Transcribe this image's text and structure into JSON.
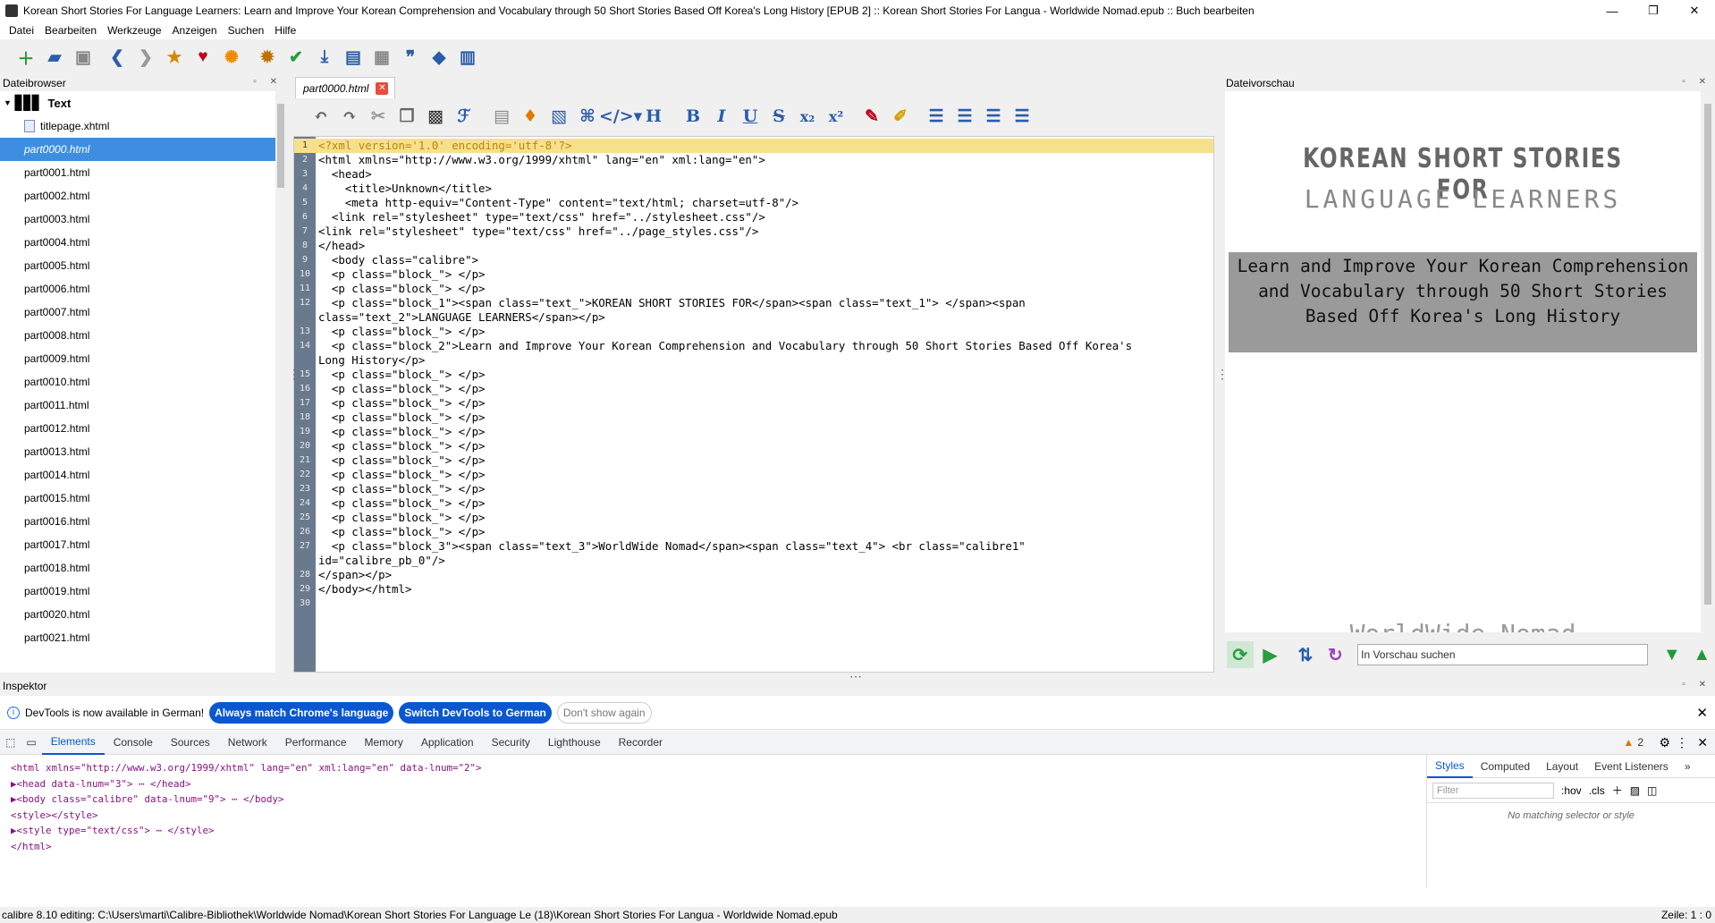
{
  "window": {
    "title": "Korean Short Stories For Language Learners: Learn and Improve Your Korean Comprehension and Vocabulary through 50 Short Stories Based Off Korea's Long History [EPUB 2] :: Korean Short Stories For Langua - Worldwide Nomad.epub :: Buch bearbeiten",
    "minimize": "—",
    "maximize": "❐",
    "close": "✕"
  },
  "menu": {
    "items": [
      "Datei",
      "Bearbeiten",
      "Werkzeuge",
      "Anzeigen",
      "Suchen",
      "Hilfe"
    ]
  },
  "file_browser": {
    "title": "Dateibrowser",
    "root": "Text",
    "selected": "part0000.html",
    "items": [
      "titlepage.xhtml",
      "part0000.html",
      "part0001.html",
      "part0002.html",
      "part0003.html",
      "part0004.html",
      "part0005.html",
      "part0006.html",
      "part0007.html",
      "part0008.html",
      "part0009.html",
      "part0010.html",
      "part0011.html",
      "part0012.html",
      "part0013.html",
      "part0014.html",
      "part0015.html",
      "part0016.html",
      "part0017.html",
      "part0018.html",
      "part0019.html",
      "part0020.html",
      "part0021.html"
    ]
  },
  "editor": {
    "tab": "part0000.html",
    "current_line": 1,
    "lines": [
      {
        "n": "1",
        "t": "<?xml version='1.0' encoding='utf-8'?>"
      },
      {
        "n": "2",
        "t": "<html xmlns=\"http://www.w3.org/1999/xhtml\" lang=\"en\" xml:lang=\"en\">"
      },
      {
        "n": "3",
        "t": "  <head>"
      },
      {
        "n": "4",
        "t": "    <title>Unknown</title>"
      },
      {
        "n": "5",
        "t": "    <meta http-equiv=\"Content-Type\" content=\"text/html; charset=utf-8\"/>"
      },
      {
        "n": "6",
        "t": "  <link rel=\"stylesheet\" type=\"text/css\" href=\"../stylesheet.css\"/>"
      },
      {
        "n": "7",
        "t": "<link rel=\"stylesheet\" type=\"text/css\" href=\"../page_styles.css\"/>"
      },
      {
        "n": "8",
        "t": "</head>"
      },
      {
        "n": "9",
        "t": "  <body class=\"calibre\">"
      },
      {
        "n": "10",
        "t": "  <p class=\"block_\"> </p>"
      },
      {
        "n": "11",
        "t": "  <p class=\"block_\"> </p>"
      },
      {
        "n": "12",
        "t": "  <p class=\"block_1\"><span class=\"text_\">KOREAN SHORT STORIES FOR</span><span class=\"text_1\"> </span><span"
      },
      {
        "n": "",
        "t": "class=\"text_2\">LANGUAGE LEARNERS</span></p>"
      },
      {
        "n": "13",
        "t": "  <p class=\"block_\"> </p>"
      },
      {
        "n": "14",
        "t": "  <p class=\"block_2\">Learn and Improve Your Korean Comprehension and Vocabulary through 50 Short Stories Based Off Korea's"
      },
      {
        "n": "",
        "t": "Long History</p>"
      },
      {
        "n": "15",
        "t": "  <p class=\"block_\"> </p>"
      },
      {
        "n": "16",
        "t": "  <p class=\"block_\"> </p>"
      },
      {
        "n": "17",
        "t": "  <p class=\"block_\"> </p>"
      },
      {
        "n": "18",
        "t": "  <p class=\"block_\"> </p>"
      },
      {
        "n": "19",
        "t": "  <p class=\"block_\"> </p>"
      },
      {
        "n": "20",
        "t": "  <p class=\"block_\"> </p>"
      },
      {
        "n": "21",
        "t": "  <p class=\"block_\"> </p>"
      },
      {
        "n": "22",
        "t": "  <p class=\"block_\"> </p>"
      },
      {
        "n": "23",
        "t": "  <p class=\"block_\"> </p>"
      },
      {
        "n": "24",
        "t": "  <p class=\"block_\"> </p>"
      },
      {
        "n": "25",
        "t": "  <p class=\"block_\"> </p>"
      },
      {
        "n": "26",
        "t": "  <p class=\"block_\"> </p>"
      },
      {
        "n": "27",
        "t": "  <p class=\"block_3\"><span class=\"text_3\">WorldWide Nomad</span><span class=\"text_4\"> <br class=\"calibre1\""
      },
      {
        "n": "",
        "t": "id=\"calibre_pb_0\"/>"
      },
      {
        "n": "28",
        "t": "</span></p>"
      },
      {
        "n": "29",
        "t": "</body></html>"
      },
      {
        "n": "30",
        "t": ""
      }
    ]
  },
  "preview": {
    "title": "Dateivorschau",
    "heading1": "KOREAN SHORT STORIES FOR",
    "heading2": "LANGUAGE LEARNERS",
    "subtitle": "Learn and Improve Your Korean Comprehension and Vocabulary through 50 Short Stories Based Off Korea's Long History",
    "footer": "WorldWide Nomad",
    "search_placeholder": "In Vorschau suchen"
  },
  "inspector": {
    "title": "Inspektor",
    "info": "DevTools is now available in German!",
    "btn_match": "Always match Chrome's language",
    "btn_switch": "Switch DevTools to German",
    "btn_dont": "Don't show again",
    "tabs": [
      "Elements",
      "Console",
      "Sources",
      "Network",
      "Performance",
      "Memory",
      "Application",
      "Security",
      "Lighthouse",
      "Recorder"
    ],
    "warnings": "2",
    "dom": [
      "<html xmlns=\"http://www.w3.org/1999/xhtml\" lang=\"en\" xml:lang=\"en\" data-lnum=\"2\">",
      "▶<head data-lnum=\"3\"> ⋯ </head>",
      "▶<body class=\"calibre\" data-lnum=\"9\"> ⋯ </body>",
      "<style></style>",
      "▶<style type=\"text/css\"> ⋯ </style>",
      "</html>"
    ],
    "styles_tabs": [
      "Styles",
      "Computed",
      "Layout",
      "Event Listeners"
    ],
    "filter": "Filter",
    "hov": ":hov",
    "cls": ".cls",
    "empty": "No matching selector or style"
  },
  "status": {
    "left": "calibre 8.10 editing: C:\\Users\\marti\\Calibre-Bibliothek\\Worldwide Nomad\\Korean Short Stories For Language Le (18)\\Korean Short Stories For Langua - Worldwide Nomad.epub",
    "right": "Zeile: 1 : 0"
  }
}
